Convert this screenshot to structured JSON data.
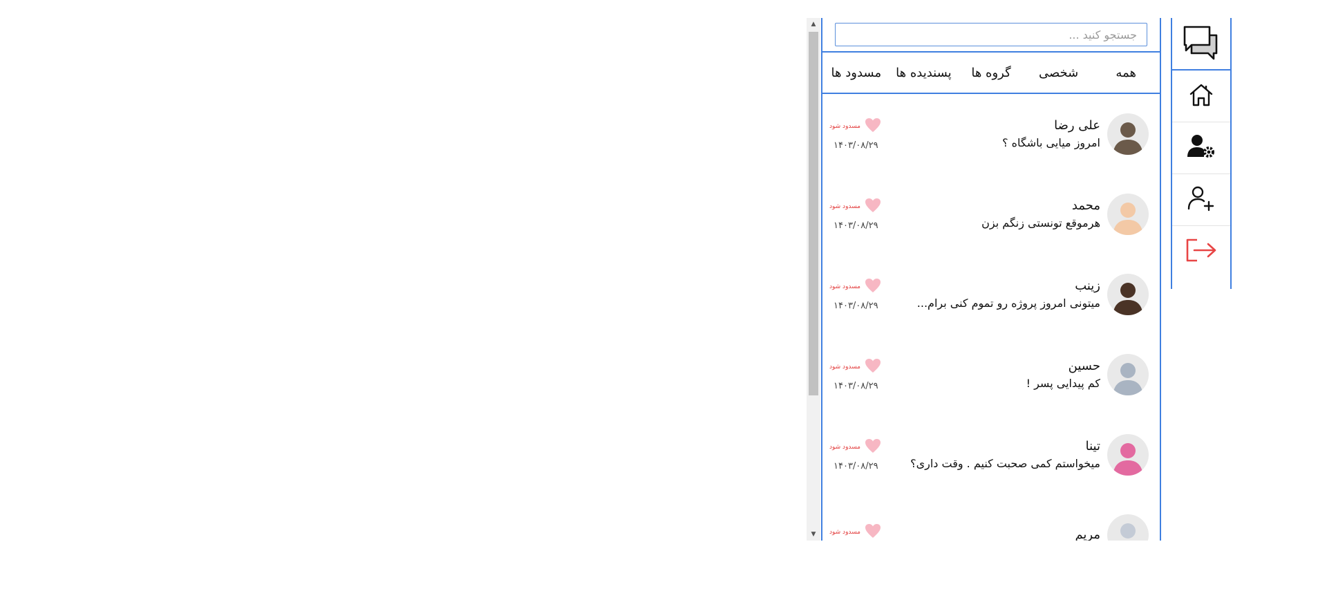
{
  "search": {
    "placeholder": "جستجو کنید ..."
  },
  "tabs": [
    {
      "label": "همه"
    },
    {
      "label": "شخصی"
    },
    {
      "label": "گروه ها"
    },
    {
      "label": "پسندیده ها"
    },
    {
      "label": "مسدود ها"
    }
  ],
  "chats": [
    {
      "name": "علی رضا",
      "message": "امروز میایی باشگاه ؟",
      "date": "۱۴۰۳/۰۸/۲۹",
      "block_label": "مسدود شود",
      "avatar_color": "#6b5a4a"
    },
    {
      "name": "محمد",
      "message": "هرموقع تونستی زنگم بزن",
      "date": "۱۴۰۳/۰۸/۲۹",
      "block_label": "مسدود شود",
      "avatar_color": "#f3c9a6"
    },
    {
      "name": "زینب",
      "message": "میتونی امروز پروژه رو تموم کنی برام...",
      "date": "۱۴۰۳/۰۸/۲۹",
      "block_label": "مسدود شود",
      "avatar_color": "#4a3326"
    },
    {
      "name": "حسین",
      "message": "کم پیدایی پسر !",
      "date": "۱۴۰۳/۰۸/۲۹",
      "block_label": "مسدود شود",
      "avatar_color": "#a9b4c2"
    },
    {
      "name": "تینا",
      "message": "میخواستم کمی صحبت کنیم . وقت داری؟",
      "date": "۱۴۰۳/۰۸/۲۹",
      "block_label": "مسدود شود",
      "avatar_color": "#e36aa0"
    },
    {
      "name": "مریم",
      "message": "",
      "date": "",
      "block_label": "مسدود شود",
      "avatar_color": "#c4cbd6"
    }
  ],
  "colors": {
    "accent": "#3f7fe0",
    "heart": "#f7b7c3",
    "block": "#e23b3b",
    "logout": "#e84545"
  },
  "rail": {
    "logo_icon": "chat-bubbles-icon",
    "items": [
      {
        "icon": "home-icon"
      },
      {
        "icon": "user-settings-icon"
      },
      {
        "icon": "add-user-icon"
      },
      {
        "icon": "logout-icon"
      }
    ]
  }
}
